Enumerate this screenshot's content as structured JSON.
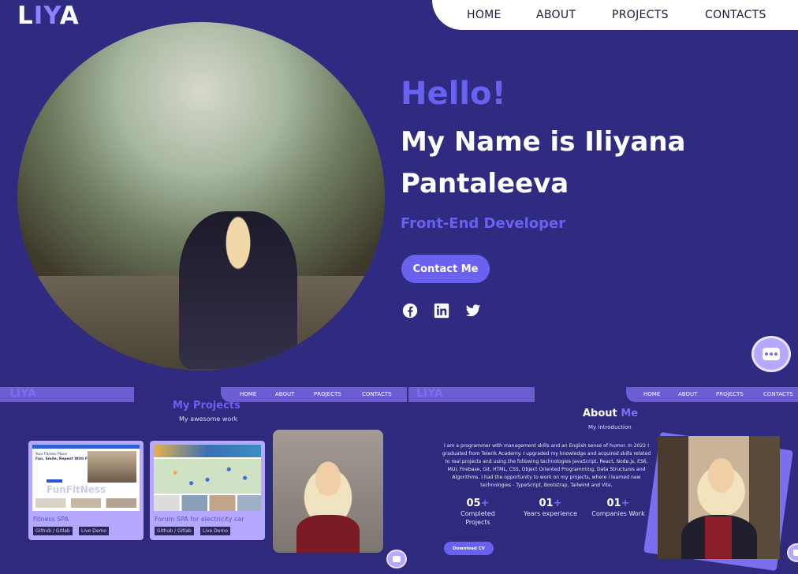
{
  "hero": {
    "logo": {
      "part1": "L",
      "part2": "IY",
      "part3": "A"
    },
    "nav": [
      "HOME",
      "ABOUT",
      "PROJECTS",
      "CONTACTS"
    ],
    "greeting": "Hello!",
    "name": "My Name is Iliyana Pantaleeva",
    "role": "Front-End Developer",
    "contact_button": "Contact Me",
    "social_icons": [
      "facebook-icon",
      "linkedin-icon",
      "twitter-icon"
    ]
  },
  "projects_panel": {
    "logo": "LIYA",
    "nav": [
      "HOME",
      "ABOUT",
      "PROJECTS",
      "CONTACTS"
    ],
    "title": "My Projects",
    "subtitle": "My awesome work",
    "cards": [
      {
        "title": "Fitness SPA",
        "buttons": [
          "Github / Gitlab",
          "Live Demo"
        ],
        "screenshot_text": "Fun, Smile, Repeat With Friends",
        "screenshot_header": "Your Fitness Place",
        "watermark": "FunFitNess"
      },
      {
        "title": "Forum SPA for electricity car",
        "buttons": [
          "Github / Gitlab",
          "Live Demo"
        ]
      }
    ]
  },
  "about_panel": {
    "logo": "LIYA",
    "nav": [
      "HOME",
      "ABOUT",
      "PROJECTS",
      "CONTACTS"
    ],
    "title_part1": "About",
    "title_part2": "Me",
    "subtitle": "My introduction",
    "text": "I am a programmer with management skills and an English sense of humor. In 2022 I graduated from Telerik Academy. I upgraded my knowledge and acquired skills related to real projects and using the following technologies JavaScript, React, Node.js, ES6, MUI, Firebase, Git, HTML, CSS, Object Oriented Programming, Data Structures and Algorithms. I had the opportunity to work on my projects, where I learned new technologies - TypeScript, Bootstrap, Tailwind and Vite.",
    "stats": [
      {
        "number": "05",
        "plus": "+",
        "label": "Completed Projects"
      },
      {
        "number": "01",
        "plus": "+",
        "label": "Years experience"
      },
      {
        "number": "01",
        "plus": "+",
        "label": "Companies Work"
      }
    ],
    "cv_button": "Download CV"
  },
  "colors": {
    "background": "#2e2a7e",
    "accent": "#6a61f1",
    "card": "#b7a8ff"
  }
}
